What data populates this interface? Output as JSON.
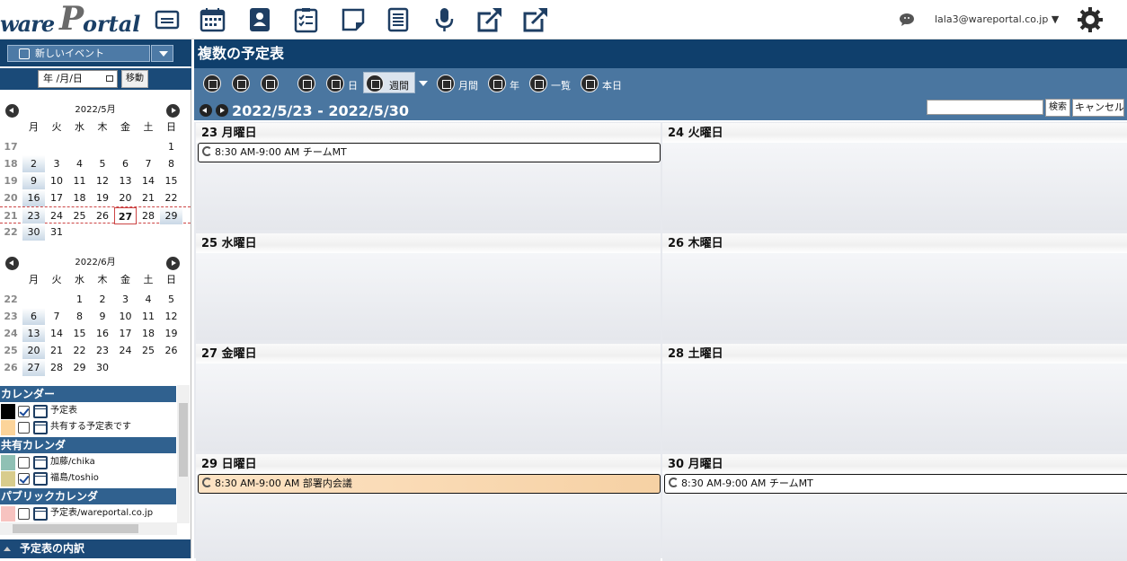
{
  "brand": {
    "logo": "wareportal"
  },
  "top_icons": [
    "id-card-icon",
    "calendar-icon",
    "address-book-icon",
    "todo-list-icon",
    "sticky-note-icon",
    "document-icon",
    "microphone-icon",
    "external-link-icon",
    "external-link-icon"
  ],
  "user": {
    "email": "lala3@wareportal.co.jp"
  },
  "sidebar": {
    "new_event": "新しいイベント",
    "date_placeholder": "年 /月/日",
    "move": "移動",
    "mini1": {
      "title": "2022/5月",
      "dow": [
        "月",
        "火",
        "水",
        "木",
        "金",
        "土",
        "日"
      ],
      "weeks": [
        {
          "wk": "17",
          "days": [
            "",
            "",
            "",
            "",
            "",
            "",
            "1"
          ]
        },
        {
          "wk": "18",
          "days": [
            "2",
            "3",
            "4",
            "5",
            "6",
            "7",
            "8"
          ]
        },
        {
          "wk": "19",
          "days": [
            "9",
            "10",
            "11",
            "12",
            "13",
            "14",
            "15"
          ]
        },
        {
          "wk": "20",
          "days": [
            "16",
            "17",
            "18",
            "19",
            "20",
            "21",
            "22"
          ]
        },
        {
          "wk": "21",
          "days": [
            "23",
            "24",
            "25",
            "26",
            "27",
            "28",
            "29"
          ]
        },
        {
          "wk": "22",
          "days": [
            "30",
            "31",
            "",
            "",
            "",
            "",
            ""
          ]
        }
      ],
      "today": "27"
    },
    "mini2": {
      "title": "2022/6月",
      "dow": [
        "月",
        "火",
        "水",
        "木",
        "金",
        "土",
        "日"
      ],
      "weeks": [
        {
          "wk": "22",
          "days": [
            "",
            "",
            "1",
            "2",
            "3",
            "4",
            "5"
          ]
        },
        {
          "wk": "23",
          "days": [
            "6",
            "7",
            "8",
            "9",
            "10",
            "11",
            "12"
          ]
        },
        {
          "wk": "24",
          "days": [
            "13",
            "14",
            "15",
            "16",
            "17",
            "18",
            "19"
          ]
        },
        {
          "wk": "25",
          "days": [
            "20",
            "21",
            "22",
            "23",
            "24",
            "25",
            "26"
          ]
        },
        {
          "wk": "26",
          "days": [
            "27",
            "28",
            "29",
            "30",
            "",
            "",
            ""
          ]
        }
      ]
    },
    "groups": [
      {
        "title": "カレンダー",
        "items": [
          {
            "label": "予定表",
            "color": "#000000",
            "checked": true
          },
          {
            "label": "共有する予定表です",
            "color": "#fcd49a",
            "checked": false
          }
        ]
      },
      {
        "title": "共有カレンダ",
        "items": [
          {
            "label": "加藤/chika",
            "color": "#8fc0b4",
            "checked": false
          },
          {
            "label": "福島/toshio",
            "color": "#d8cc8c",
            "checked": true
          }
        ]
      },
      {
        "title": "パブリックカレンダ",
        "items": [
          {
            "label": "予定表/wareportal.co.jp",
            "color": "#f7c3c0",
            "checked": false
          }
        ]
      }
    ],
    "breakdown": "予定表の内訳"
  },
  "main": {
    "title": "複数の予定表",
    "toolbar": {
      "day": "日",
      "week": "週間",
      "month": "月間",
      "year": "年",
      "list": "一覧",
      "today": "本日"
    },
    "range": "2022/5/23 - 2022/5/30",
    "search": "検索",
    "cancel": "キャンセル",
    "days": [
      {
        "label": "23 月曜日",
        "events": [
          {
            "text": "8:30 AM-9:00 AM チームMT",
            "style": "white"
          }
        ]
      },
      {
        "label": "24 火曜日",
        "events": []
      },
      {
        "label": "25 水曜日",
        "events": []
      },
      {
        "label": "26 木曜日",
        "events": []
      },
      {
        "label": "27 金曜日",
        "events": []
      },
      {
        "label": "28 土曜日",
        "events": []
      },
      {
        "label": "29 日曜日",
        "events": [
          {
            "text": "8:30 AM-9:00 AM 部署内会議",
            "style": "orange"
          }
        ]
      },
      {
        "label": "30 月曜日",
        "events": [
          {
            "text": "8:30 AM-9:00 AM チームMT",
            "style": "white"
          }
        ]
      }
    ]
  }
}
